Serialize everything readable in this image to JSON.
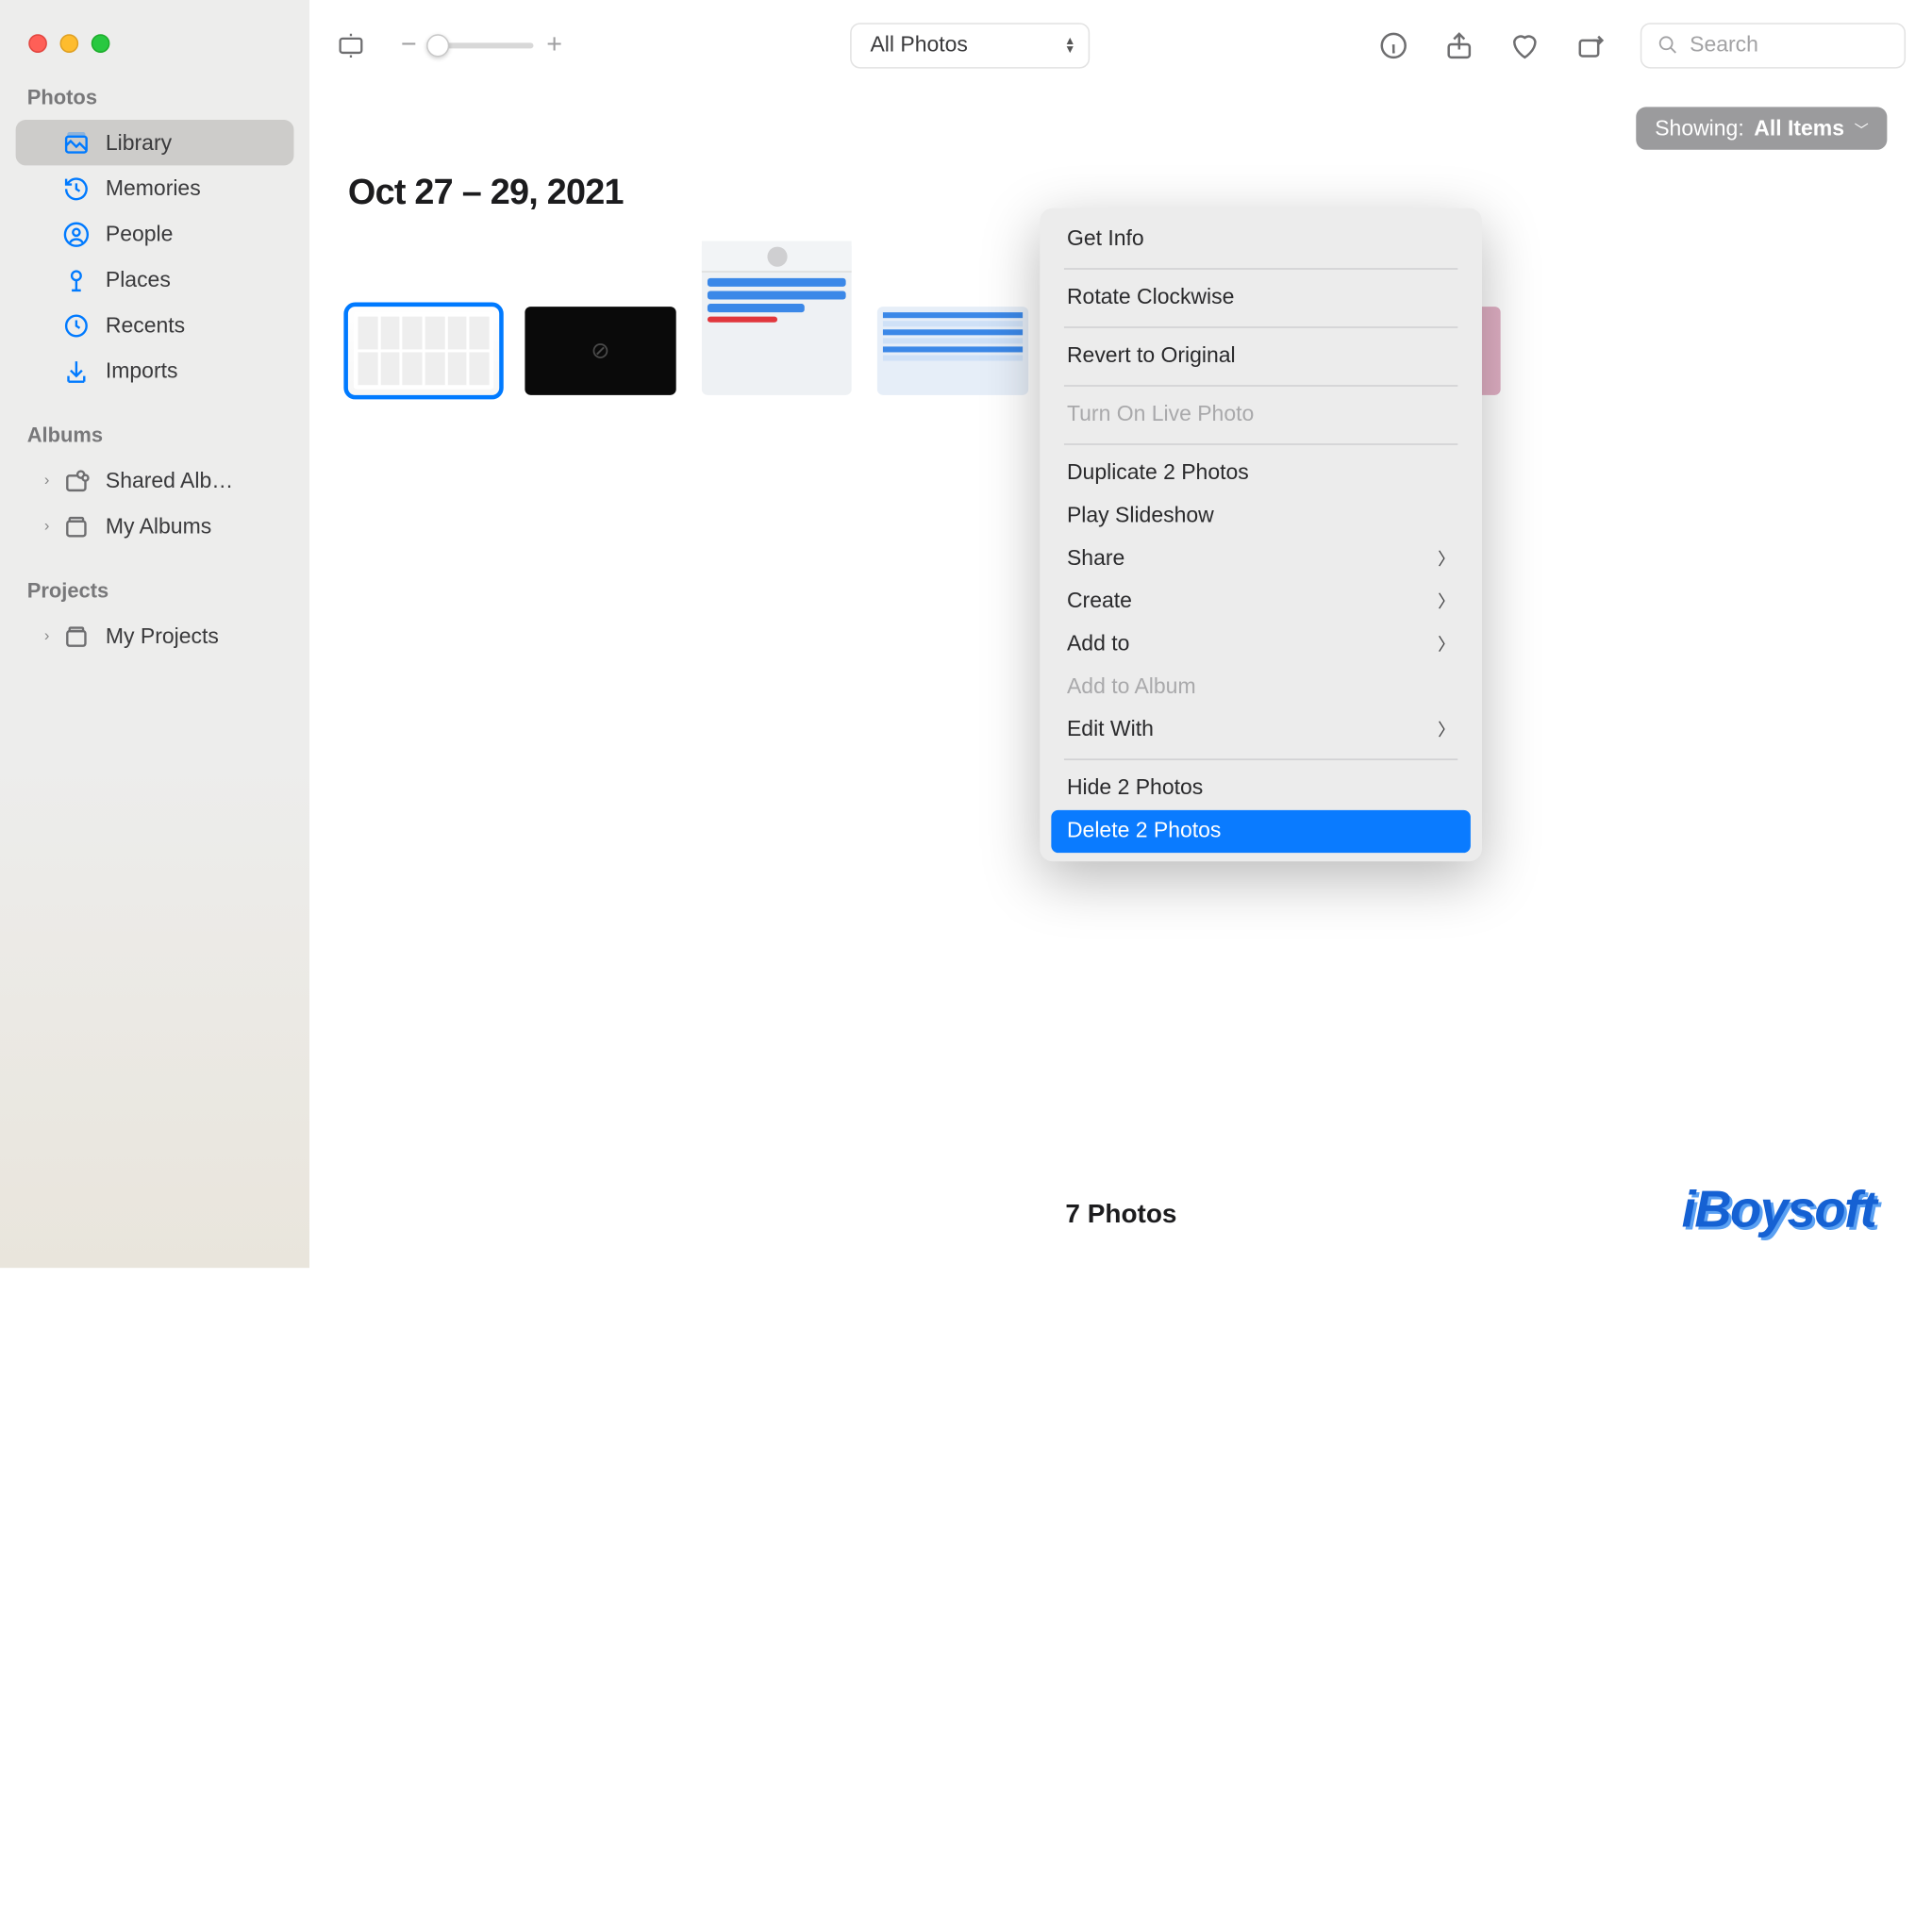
{
  "toolbar": {
    "view_select": "All Photos",
    "search_placeholder": "Search"
  },
  "showing": {
    "label": "Showing:",
    "value": "All Items"
  },
  "sidebar": {
    "sections": {
      "photos": "Photos",
      "albums": "Albums",
      "projects": "Projects"
    },
    "items": [
      {
        "label": "Library",
        "icon": "library-icon",
        "selected": true
      },
      {
        "label": "Memories",
        "icon": "clock-back-icon"
      },
      {
        "label": "People",
        "icon": "person-circle-icon"
      },
      {
        "label": "Places",
        "icon": "pin-icon"
      },
      {
        "label": "Recents",
        "icon": "clock-icon"
      },
      {
        "label": "Imports",
        "icon": "download-icon"
      }
    ],
    "albums_items": [
      {
        "label": "Shared Alb…",
        "icon": "shared-album-icon",
        "disclosure": true
      },
      {
        "label": "My Albums",
        "icon": "album-icon",
        "disclosure": true
      }
    ],
    "projects_items": [
      {
        "label": "My Projects",
        "icon": "album-icon",
        "disclosure": true
      }
    ]
  },
  "main": {
    "date_heading": "Oct 27 – 29, 2021",
    "photo_count": "7 Photos"
  },
  "thumbnails": [
    {
      "selected": true,
      "type": "white-ui"
    },
    {
      "selected": false,
      "type": "black"
    },
    {
      "selected": false,
      "type": "tall-dialog"
    },
    {
      "selected": false,
      "type": "blue-table"
    },
    {
      "selected": true,
      "type": "yellow-ui",
      "favorite": true
    },
    {
      "selected": false,
      "type": "gray-small"
    },
    {
      "selected": false,
      "type": "pink"
    }
  ],
  "context_menu": {
    "items": [
      {
        "label": "Get Info",
        "type": "normal"
      },
      {
        "type": "sep"
      },
      {
        "label": "Rotate Clockwise",
        "type": "normal"
      },
      {
        "type": "sep"
      },
      {
        "label": "Revert to Original",
        "type": "normal"
      },
      {
        "type": "sep"
      },
      {
        "label": "Turn On Live Photo",
        "type": "disabled"
      },
      {
        "type": "sep"
      },
      {
        "label": "Duplicate 2 Photos",
        "type": "normal"
      },
      {
        "label": "Play Slideshow",
        "type": "normal"
      },
      {
        "label": "Share",
        "type": "submenu"
      },
      {
        "label": "Create",
        "type": "submenu"
      },
      {
        "label": "Add to",
        "type": "submenu"
      },
      {
        "label": "Add to Album",
        "type": "disabled"
      },
      {
        "label": "Edit With",
        "type": "submenu"
      },
      {
        "type": "sep"
      },
      {
        "label": "Hide 2 Photos",
        "type": "normal"
      },
      {
        "label": "Delete 2 Photos",
        "type": "highlighted"
      }
    ]
  },
  "watermark": "iBoysoft"
}
